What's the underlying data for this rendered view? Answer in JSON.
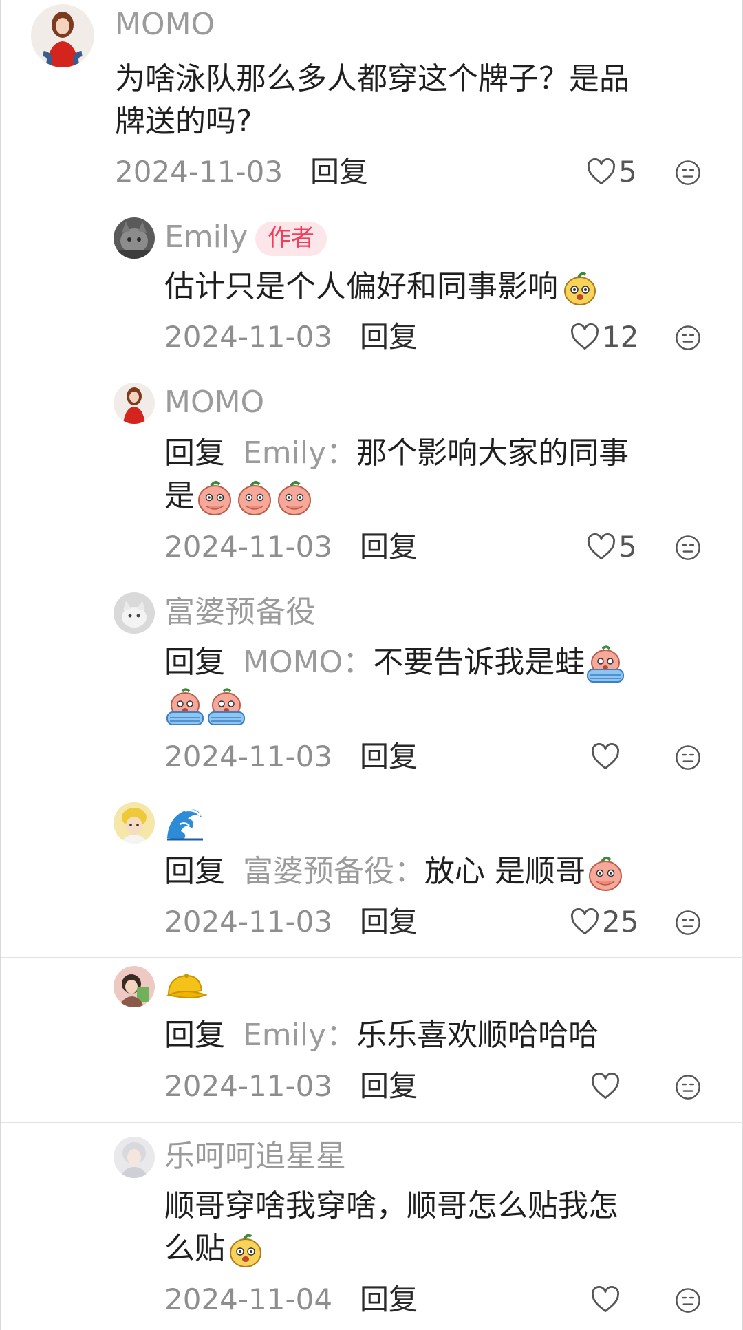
{
  "comments": [
    {
      "username": "MOMO",
      "text": "为啥泳队那么多人都穿这个牌子？是品",
      "text_line2": "牌送的吗?",
      "date": "2024-11-03",
      "reply_label": "回复",
      "likes": "5"
    },
    {
      "username": "Emily",
      "badge": "作者",
      "text": "估计只是个人偏好和同事影响",
      "date": "2024-11-03",
      "reply_label": "回复",
      "likes": "12"
    },
    {
      "username": "MOMO",
      "reply_keyword": "回复",
      "reply_target": "Emily：",
      "text": "那个影响大家的同事",
      "text_line2": "是",
      "date": "2024-11-03",
      "reply_label": "回复",
      "likes": "5"
    },
    {
      "username": "富婆预备役",
      "reply_keyword": "回复",
      "reply_target": "MOMO：",
      "text": "不要告诉我是蛙",
      "date": "2024-11-03",
      "reply_label": "回复",
      "likes": ""
    },
    {
      "username_icon": "wave-emoji-icon",
      "reply_keyword": "回复",
      "reply_target": "富婆预备役：",
      "text": "放心 是顺哥",
      "date": "2024-11-03",
      "reply_label": "回复",
      "likes": "25"
    },
    {
      "username_icon": "yellow-cap-emoji-icon",
      "reply_keyword": "回复",
      "reply_target": "Emily：",
      "text": "乐乐喜欢顺哈哈哈",
      "date": "2024-11-03",
      "reply_label": "回复",
      "likes": ""
    },
    {
      "username": "乐呵呵追星星",
      "text": "顺哥穿啥我穿啥，顺哥怎么贴我怎",
      "text_line2": "么贴",
      "date": "2024-11-04",
      "reply_label": "回复",
      "likes": ""
    }
  ],
  "colors": {
    "author_badge_bg": "#fde6ea",
    "author_badge_text": "#f23d5c",
    "username": "#9b9b9b"
  }
}
